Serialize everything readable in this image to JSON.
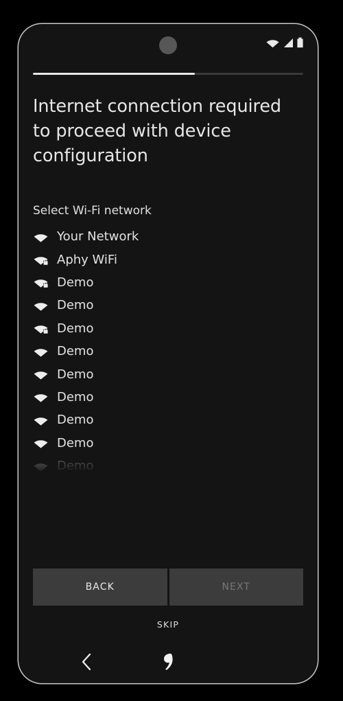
{
  "status_bar": {
    "wifi_icon": "wifi-icon",
    "signal_icon": "cellular-signal-icon",
    "battery_icon": "battery-icon",
    "camera_icon": "front-camera-dot"
  },
  "progress": {
    "percent": 60
  },
  "header": {
    "title": "Internet connection required to proceed with device configuration"
  },
  "wifi_section": {
    "label": "Select Wi-Fi network",
    "networks": [
      {
        "name": "Your Network",
        "secured": false,
        "faded": false
      },
      {
        "name": "Aphy WiFi",
        "secured": true,
        "faded": false
      },
      {
        "name": "Demo",
        "secured": true,
        "faded": false
      },
      {
        "name": "Demo",
        "secured": false,
        "faded": false
      },
      {
        "name": "Demo",
        "secured": true,
        "faded": false
      },
      {
        "name": "Demo",
        "secured": false,
        "faded": false
      },
      {
        "name": "Demo",
        "secured": false,
        "faded": false
      },
      {
        "name": "Demo",
        "secured": false,
        "faded": false
      },
      {
        "name": "Demo",
        "secured": false,
        "faded": false
      },
      {
        "name": "Demo",
        "secured": false,
        "faded": false
      },
      {
        "name": "Demo",
        "secured": false,
        "faded": true
      }
    ]
  },
  "footer": {
    "back_label": "BACK",
    "next_label": "NEXT",
    "next_disabled": true,
    "skip_label": "SKIP"
  },
  "nav_bar": {
    "back_icon": "chevron-left-icon",
    "home_icon": "home-comma-icon"
  },
  "colors": {
    "screen_background": "#141414",
    "frame_border": "#c9c9c9",
    "text_primary": "#e6e6e6",
    "button_fill": "#3c3c3c",
    "button_disabled_text": "#777777",
    "progress_fill": "#e8e8e8",
    "progress_track": "#3a3a3a"
  }
}
